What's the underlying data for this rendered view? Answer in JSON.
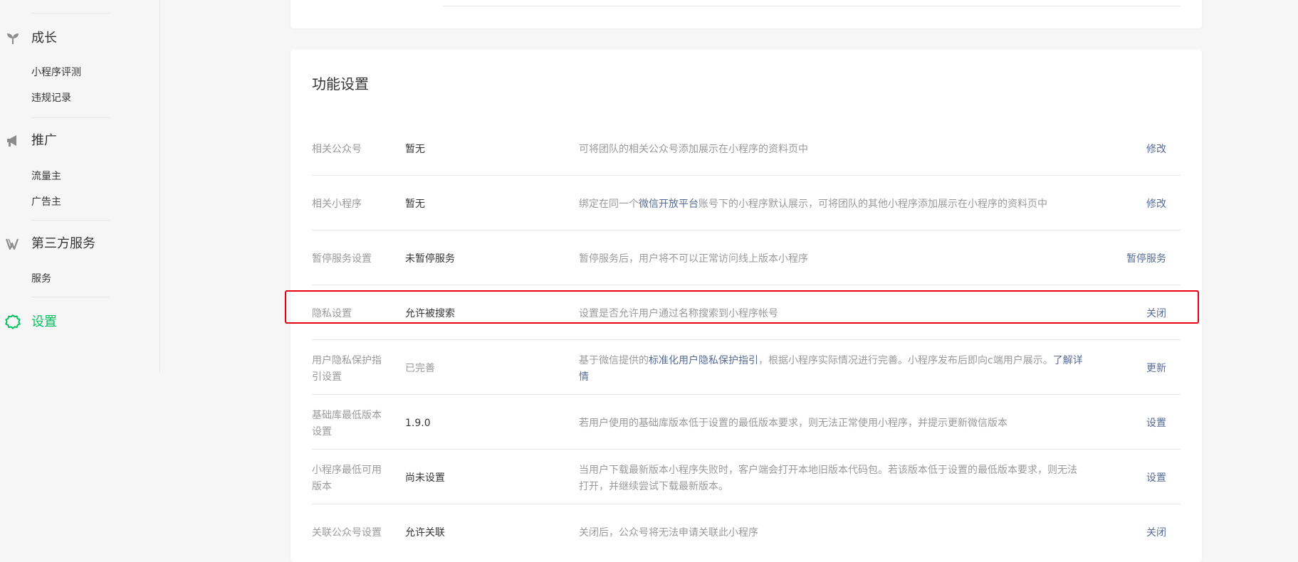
{
  "sidebar": {
    "sections": [
      {
        "title": "成长",
        "icon": "sprout-icon",
        "items": [
          "小程序评测",
          "违规记录"
        ]
      },
      {
        "title": "推广",
        "icon": "megaphone-icon",
        "items": [
          "流量主",
          "广告主"
        ]
      },
      {
        "title": "第三方服务",
        "icon": "third-party-icon",
        "items": [
          "服务"
        ]
      },
      {
        "title": "设置",
        "icon": "gear-icon",
        "items": []
      }
    ]
  },
  "feature_settings": {
    "title": "功能设置",
    "rows": [
      {
        "label": "相关公众号",
        "value": "暂无",
        "desc": "可将团队的相关公众号添加展示在小程序的资料页中",
        "action": "修改"
      },
      {
        "label": "相关小程序",
        "value": "暂无",
        "desc_pre": "绑定在同一个",
        "desc_link": "微信开放平台",
        "desc_post": "账号下的小程序默认展示，可将团队的其他小程序添加展示在小程序的资料页中",
        "action": "修改"
      },
      {
        "label": "暂停服务设置",
        "value": "未暂停服务",
        "desc": "暂停服务后，用户将不可以正常访问线上版本小程序",
        "action": "暂停服务"
      },
      {
        "label": "隐私设置",
        "value": "允许被搜索",
        "desc": "设置是否允许用户通过名称搜索到小程序帐号",
        "action": "关闭"
      },
      {
        "label": "用户隐私保护指引设置",
        "value": "已完善",
        "desc_pre": "基于微信提供的",
        "desc_link": "标准化用户隐私保护指引",
        "desc_mid": "，根据小程序实际情况进行完善。小程序发布后即向c端用户展示。",
        "desc_link2": "了解详情",
        "action": "更新"
      },
      {
        "label": "基础库最低版本设置",
        "value": "1.9.0",
        "desc": "若用户使用的基础库版本低于设置的最低版本要求，则无法正常使用小程序，并提示更新微信版本",
        "action": "设置"
      },
      {
        "label": "小程序最低可用版本",
        "value": "尚未设置",
        "desc": "当用户下载最新版本小程序失败时，客户端会打开本地旧版本代码包。若该版本低于设置的最低版本要求，则无法打开，并继续尝试下载最新版本。",
        "action": "设置"
      },
      {
        "label": "关联公众号设置",
        "value": "允许关联",
        "desc": "关闭后，公众号将无法申请关联此小程序",
        "action": "关闭"
      }
    ]
  },
  "colors": {
    "accent_green": "#07c160",
    "link_blue": "#576b95",
    "highlight_red": "#e60012"
  }
}
